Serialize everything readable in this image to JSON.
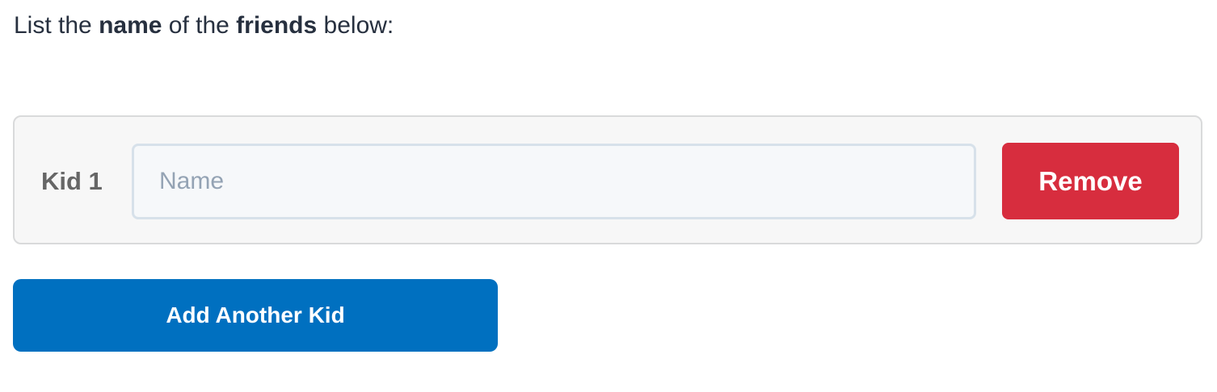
{
  "instructions": {
    "part1": "List the ",
    "bold1": "name",
    "part2": " of the ",
    "bold2": "friends",
    "part3": " below:"
  },
  "kids": {
    "items": [
      {
        "label": "Kid 1",
        "name_value": "",
        "name_placeholder": "Name",
        "remove_label": "Remove"
      }
    ]
  },
  "add_button": {
    "label": "Add Another Kid"
  },
  "colors": {
    "remove_bg": "#d72d3e",
    "add_bg": "#0070c0",
    "text": "#27303f",
    "row_bg": "#f7f7f7"
  }
}
